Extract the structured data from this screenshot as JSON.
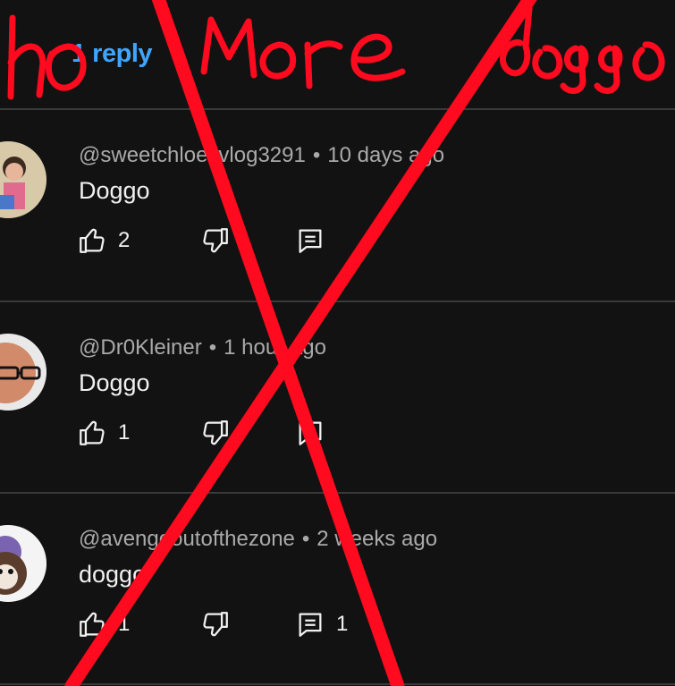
{
  "thread": {
    "reply_label": "1 reply"
  },
  "comments": [
    {
      "handle": "@sweetchloesvlog3291",
      "time": "10 days ago",
      "text": "Doggo",
      "likes": "2",
      "replies": ""
    },
    {
      "handle": "@Dr0Kleiner",
      "time": "1 hour ago",
      "text": "Doggo",
      "likes": "1",
      "replies": ""
    },
    {
      "handle": "@avengeoutofthezone",
      "time": "2 weeks ago",
      "text": "doggo",
      "likes": "1",
      "replies": "1"
    }
  ],
  "separator": "•",
  "overlay": {
    "handwriting": "no more doggo",
    "color": "#ff0a1e"
  },
  "icons": [
    "like-icon",
    "dislike-icon",
    "reply-icon"
  ],
  "colors": {
    "background": "#121212",
    "link": "#3ea6ff",
    "muted": "#aaaaaa",
    "text": "#f1f1f1"
  }
}
